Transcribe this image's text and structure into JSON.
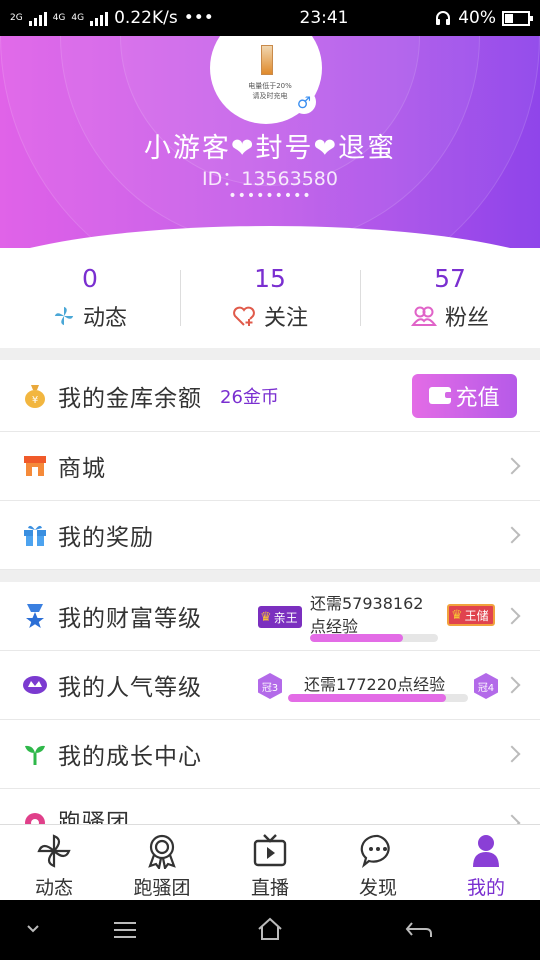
{
  "status_bar": {
    "network_tag_1": "2G",
    "network_tag_2": "4G",
    "network_tag_3": "4G",
    "speed": "0.22K/s",
    "more": "•••",
    "time": "23:41",
    "battery": "40%",
    "battery_level": 0.4
  },
  "profile": {
    "avatar_caption_1": "电量低于20%",
    "avatar_caption_2": "请及时充电",
    "nickname": "小游客❤封号❤退蜜",
    "user_id": "ID：13563580",
    "signature": "•••••••••"
  },
  "stats": [
    {
      "value": "0",
      "label": "动态",
      "icon": "pinwheel-icon"
    },
    {
      "value": "15",
      "label": "关注",
      "icon": "heart-plus-icon"
    },
    {
      "value": "57",
      "label": "粉丝",
      "icon": "fans-icon"
    }
  ],
  "wallet": {
    "label": "我的金库余额",
    "amount": "26金币",
    "recharge_label": "充值",
    "icon": "money-bag-icon"
  },
  "menu": {
    "shop": "商城",
    "rewards": "我的奖励",
    "wealth_level": {
      "label": "我的财富等级",
      "current_tag": "亲王",
      "next_tag": "王储",
      "text_line1": "还需57938162",
      "text_line2": "点经验",
      "progress": 0.73
    },
    "popularity_level": {
      "label": "我的人气等级",
      "current_tag": "冠3",
      "next_tag": "冠4",
      "text": "还需177220点经验",
      "progress": 0.88
    },
    "growth": "我的成长中心",
    "group": "跑骚团"
  },
  "bottom_nav": [
    {
      "label": "动态",
      "icon": "pinwheel-icon"
    },
    {
      "label": "跑骚团",
      "icon": "badge-icon"
    },
    {
      "label": "直播",
      "icon": "tv-icon"
    },
    {
      "label": "发现",
      "icon": "chat-bubble-icon"
    },
    {
      "label": "我的",
      "icon": "user-icon",
      "active": true
    }
  ],
  "colors": {
    "accent": "#7a2fd0",
    "header_start": "#e063e8",
    "header_end": "#8f45ea"
  }
}
